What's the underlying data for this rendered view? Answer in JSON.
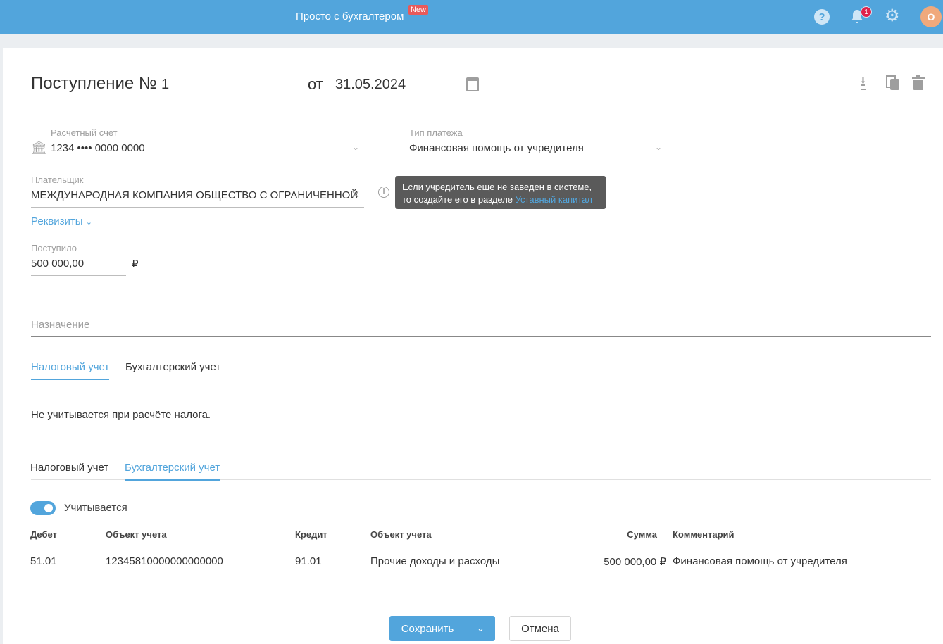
{
  "header": {
    "brand": "Просто с бухгалтером",
    "new_badge": "New",
    "notifications_count": "1",
    "avatar_letter": "О"
  },
  "doc": {
    "title": "Поступление №",
    "number": "1",
    "from_label": "от",
    "date": "31.05.2024"
  },
  "fields": {
    "account_label": "Расчетный счет",
    "account_value": "1234 •••• 0000 0000",
    "payment_type_label": "Тип платежа",
    "payment_type_value": "Финансовая помощь от учредителя",
    "payer_label": "Плательщик",
    "payer_value": "МЕЖДУНАРОДНАЯ КОМПАНИЯ ОБЩЕСТВО С ОГРАНИЧЕННОЙ",
    "requisites_link": "Реквизиты",
    "received_label": "Поступило",
    "received_value": "500 000,00",
    "currency": "₽",
    "purpose_placeholder": "Назначение"
  },
  "tooltip": {
    "text": "Если учредитель еще не заведен в системе,",
    "text2": "то создайте его в разделе ",
    "link": "Уставный капитал"
  },
  "tabs1": {
    "tax": "Налоговый учет",
    "accounting": "Бухгалтерский учет",
    "message": "Не учитывается при расчёте налога."
  },
  "tabs2": {
    "tax": "Налоговый учет",
    "accounting": "Бухгалтерский учет"
  },
  "toggle": {
    "label": "Учитывается",
    "on": true
  },
  "table": {
    "headers": [
      "Дебет",
      "Объект учета",
      "Кредит",
      "Объект учета",
      "Сумма",
      "Комментарий"
    ],
    "rows": [
      [
        "51.01",
        "12345810000000000000",
        "91.01",
        "Прочие доходы и расходы",
        "500 000,00 ₽",
        "Финансовая помощь от учредителя"
      ]
    ]
  },
  "buttons": {
    "save": "Сохранить",
    "cancel": "Отмена"
  }
}
